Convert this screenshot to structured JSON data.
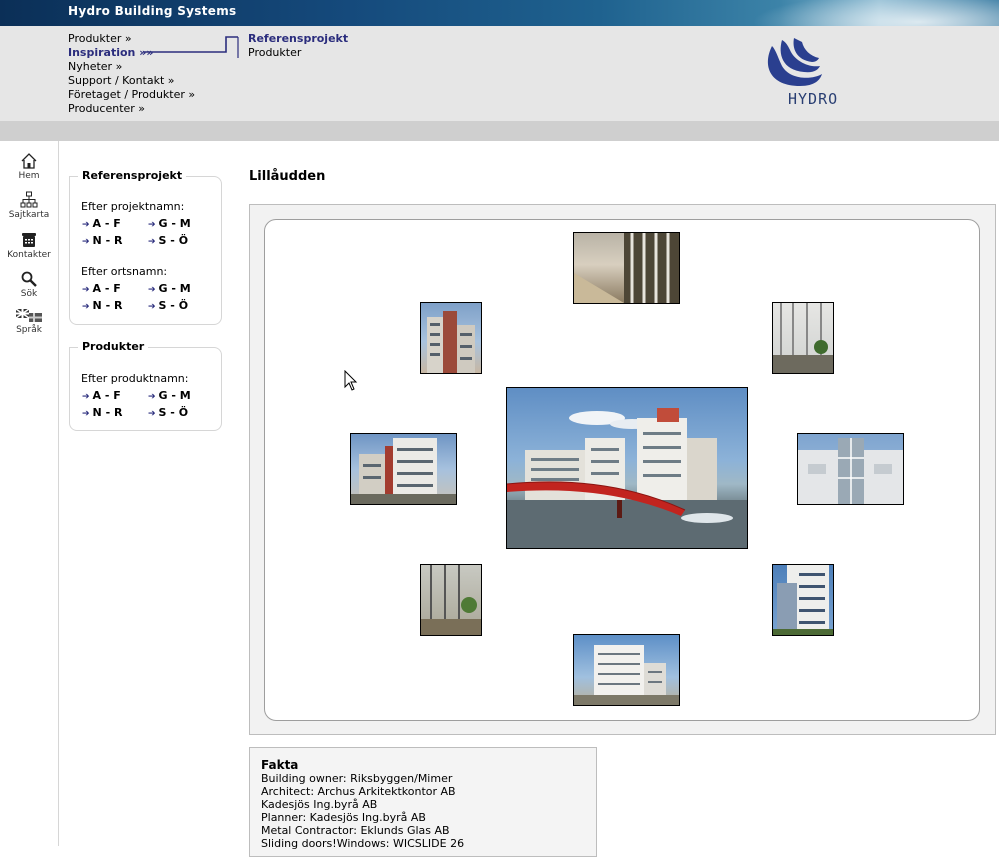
{
  "brand": {
    "title": "Hydro Building Systems",
    "logo_text": "HYDRO"
  },
  "main_nav": [
    {
      "label": "Produkter »"
    },
    {
      "label": "Inspiration »»"
    },
    {
      "label": "Nyheter »"
    },
    {
      "label": "Support / Kontakt »"
    },
    {
      "label": "Företaget / Produkter »"
    },
    {
      "label": "Producenter »"
    }
  ],
  "sub_nav": [
    {
      "label": "Referensprojekt"
    },
    {
      "label": "Produkter"
    }
  ],
  "left_nav": [
    {
      "label": "Hem",
      "icon": "home-icon"
    },
    {
      "label": "Sajtkarta",
      "icon": "sitemap-icon"
    },
    {
      "label": "Kontakter",
      "icon": "phone-icon"
    },
    {
      "label": "Sök",
      "icon": "search-icon"
    },
    {
      "label": "Språk",
      "icon": "flag-icon"
    }
  ],
  "ref_box": {
    "title": "Referensprojekt",
    "by_name_label": "Efter projektnamn:",
    "by_place_label": "Efter ortsnamn:",
    "ranges": [
      "A - F",
      "G - M",
      "N - R",
      "S - Ö"
    ]
  },
  "prod_box": {
    "title": "Produkter",
    "by_name_label": "Efter produktnamn:",
    "ranges": [
      "A - F",
      "G - M",
      "N - R",
      "S - Ö"
    ]
  },
  "page_title": "Lillåudden",
  "fakta": {
    "title": "Fakta",
    "lines": [
      "Building owner: Riksbyggen/Mimer",
      "Architect: Archus Arkitektkontor AB",
      "Kadesjös Ing.byrå AB",
      "Planner: Kadesjös Ing.byrå AB",
      "Metal Contractor: Eklunds Glas AB",
      "Sliding doors!Windows: WICSLIDE 26"
    ]
  },
  "colors": {
    "accent": "#2b2d7d",
    "header_dark": "#0b2f57",
    "nav_bg": "#e6e6e6"
  }
}
